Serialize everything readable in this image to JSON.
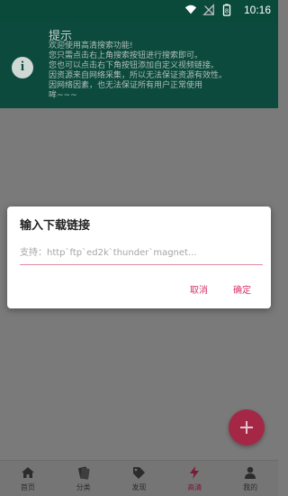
{
  "status_bar": {
    "time": "10:16",
    "battery_level": "8"
  },
  "banner": {
    "title": "提示",
    "body": "欢迎使用高清搜索功能!\n您只需点击右上角搜索按钮进行搜索即可。\n您也可以点击右下角按钮添加自定义视频链接。\n因资源来自网络采集，所以无法保证资源有效性。\n因网络因素，也无法保证所有用户正常使用\n哞~~~"
  },
  "dialog": {
    "title": "输入下载链接",
    "input_placeholder": "支持：http`ftp`ed2k`thunder`magnet...",
    "input_value": "",
    "cancel_label": "取消",
    "ok_label": "确定"
  },
  "fab": {
    "icon": "plus-icon"
  },
  "bottom_nav": {
    "items": [
      {
        "label": "首页",
        "icon": "home-icon"
      },
      {
        "label": "分类",
        "icon": "category-icon"
      },
      {
        "label": "发现",
        "icon": "tag-icon"
      },
      {
        "label": "高清",
        "icon": "lightning-icon",
        "active": true
      },
      {
        "label": "我的",
        "icon": "person-icon"
      }
    ]
  },
  "colors": {
    "banner_bg": "#0b4a3c",
    "accent": "#d6336c",
    "fab": "#a42846",
    "active_nav": "#7b1a35"
  }
}
